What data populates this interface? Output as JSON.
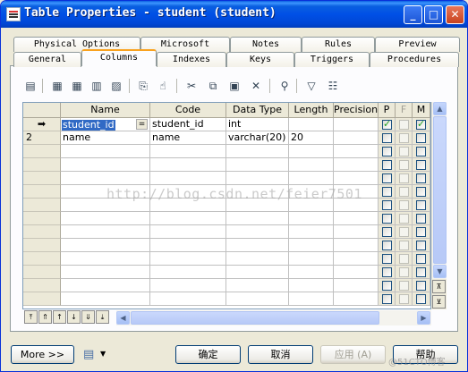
{
  "window": {
    "title": "Table Properties - student (student)"
  },
  "tabs_top": [
    "Physical Options",
    "Microsoft",
    "Notes",
    "Rules",
    "Preview"
  ],
  "tabs_bottom": [
    "General",
    "Columns",
    "Indexes",
    "Keys",
    "Triggers",
    "Procedures"
  ],
  "active_tab": "Columns",
  "grid": {
    "headers": [
      "Name",
      "Code",
      "Data Type",
      "Length",
      "Precision",
      "P",
      "F",
      "M"
    ],
    "rows": [
      {
        "marker": "➡",
        "name": "student_id",
        "code": "student_id",
        "type": "int",
        "length": "",
        "precision": "",
        "p": true,
        "f": false,
        "m": true,
        "editing": true
      },
      {
        "marker": "2",
        "name": "name",
        "code": "name",
        "type": "varchar(20)",
        "length": "20",
        "precision": "",
        "p": false,
        "f": false,
        "m": false,
        "editing": false
      }
    ],
    "edit_button": "="
  },
  "watermark": "http://blog.csdn.net/feier7501",
  "buttons": {
    "more": "More >>",
    "ok": "确定",
    "cancel": "取消",
    "apply": "应用 (A)",
    "help": "帮助"
  },
  "corner_mark": "@51CTO博客"
}
